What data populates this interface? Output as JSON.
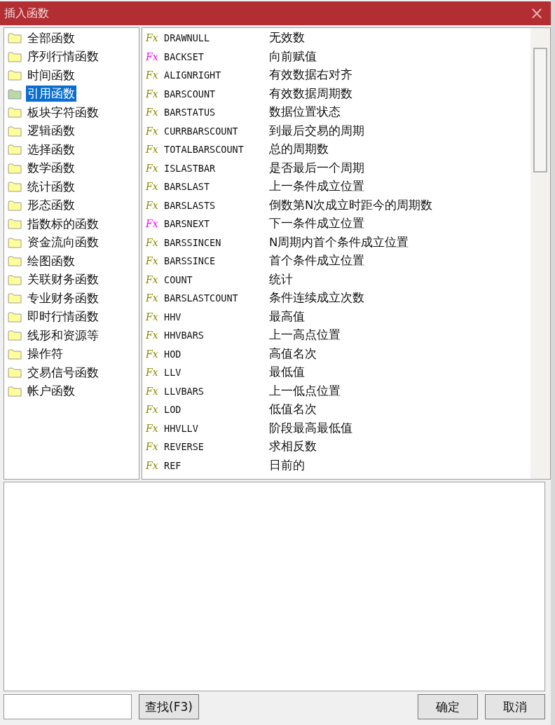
{
  "window": {
    "title": "插入函数",
    "close": "×"
  },
  "categories": [
    {
      "label": "全部函数",
      "selected": false
    },
    {
      "label": "序列行情函数",
      "selected": false
    },
    {
      "label": "时间函数",
      "selected": false
    },
    {
      "label": "引用函数",
      "selected": true
    },
    {
      "label": "板块字符函数",
      "selected": false
    },
    {
      "label": "逻辑函数",
      "selected": false
    },
    {
      "label": "选择函数",
      "selected": false
    },
    {
      "label": "数学函数",
      "selected": false
    },
    {
      "label": "统计函数",
      "selected": false
    },
    {
      "label": "形态函数",
      "selected": false
    },
    {
      "label": "指数标的函数",
      "selected": false
    },
    {
      "label": "资金流向函数",
      "selected": false
    },
    {
      "label": "绘图函数",
      "selected": false
    },
    {
      "label": "关联财务函数",
      "selected": false
    },
    {
      "label": "专业财务函数",
      "selected": false
    },
    {
      "label": "即时行情函数",
      "selected": false
    },
    {
      "label": "线形和资源等",
      "selected": false
    },
    {
      "label": "操作符",
      "selected": false
    },
    {
      "label": "交易信号函数",
      "selected": false
    },
    {
      "label": "帐户函数",
      "selected": false
    }
  ],
  "functions": [
    {
      "icon": "Fx",
      "color": "#8a8a00",
      "name": "DRAWNULL",
      "description": "无效数"
    },
    {
      "icon": "Fx",
      "color": "#ff00ff",
      "name": "BACKSET",
      "description": "向前赋值"
    },
    {
      "icon": "Fx",
      "color": "#8a8a00",
      "name": "ALIGNRIGHT",
      "description": "有效数据右对齐"
    },
    {
      "icon": "Fx",
      "color": "#8a8a00",
      "name": "BARSCOUNT",
      "description": "有效数据周期数"
    },
    {
      "icon": "Fx",
      "color": "#8a8a00",
      "name": "BARSTATUS",
      "description": "数据位置状态"
    },
    {
      "icon": "Fx",
      "color": "#8a8a00",
      "name": "CURRBARSCOUNT",
      "description": "到最后交易的周期"
    },
    {
      "icon": "Fx",
      "color": "#8a8a00",
      "name": "TOTALBARSCOUNT",
      "description": "总的周期数"
    },
    {
      "icon": "Fx",
      "color": "#8a8a00",
      "name": "ISLASTBAR",
      "description": "是否最后一个周期"
    },
    {
      "icon": "Fx",
      "color": "#8a8a00",
      "name": "BARSLAST",
      "description": "上一条件成立位置"
    },
    {
      "icon": "Fx",
      "color": "#8a8a00",
      "name": "BARSLASTS",
      "description": "倒数第N次成立时距今的周期数"
    },
    {
      "icon": "Fx",
      "color": "#ff00ff",
      "name": "BARSNEXT",
      "description": "下一条件成立位置"
    },
    {
      "icon": "Fx",
      "color": "#8a8a00",
      "name": "BARSSINCEN",
      "description": "N周期内首个条件成立位置"
    },
    {
      "icon": "Fx",
      "color": "#8a8a00",
      "name": "BARSSINCE",
      "description": "首个条件成立位置"
    },
    {
      "icon": "Fx",
      "color": "#8a8a00",
      "name": "COUNT",
      "description": "统计"
    },
    {
      "icon": "Fx",
      "color": "#8a8a00",
      "name": "BARSLASTCOUNT",
      "description": "条件连续成立次数"
    },
    {
      "icon": "Fx",
      "color": "#8a8a00",
      "name": "HHV",
      "description": "最高值"
    },
    {
      "icon": "Fx",
      "color": "#8a8a00",
      "name": "HHVBARS",
      "description": "上一高点位置"
    },
    {
      "icon": "Fx",
      "color": "#8a8a00",
      "name": "HOD",
      "description": "高值名次"
    },
    {
      "icon": "Fx",
      "color": "#8a8a00",
      "name": "LLV",
      "description": "最低值"
    },
    {
      "icon": "Fx",
      "color": "#8a8a00",
      "name": "LLVBARS",
      "description": "上一低点位置"
    },
    {
      "icon": "Fx",
      "color": "#8a8a00",
      "name": "LOD",
      "description": "低值名次"
    },
    {
      "icon": "Fx",
      "color": "#8a8a00",
      "name": "HHVLLV",
      "description": "阶段最高最低值"
    },
    {
      "icon": "Fx",
      "color": "#8a8a00",
      "name": "REVERSE",
      "description": "求相反数"
    },
    {
      "icon": "Fx",
      "color": "#8a8a00",
      "name": "REF",
      "description": "日前的"
    }
  ],
  "buttons": {
    "find": "查找(F3)",
    "ok": "确定",
    "cancel": "取消"
  }
}
